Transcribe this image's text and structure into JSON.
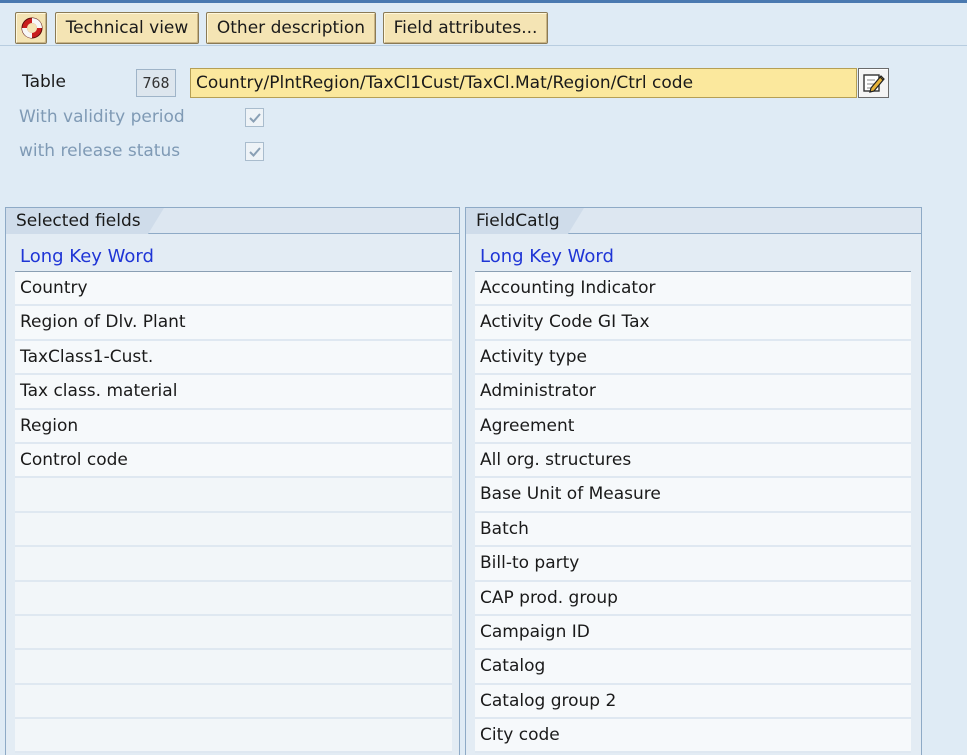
{
  "toolbar": {
    "icon": "sap-lifebuoy-icon",
    "technical_view": "Technical view",
    "other_description": "Other description",
    "field_attributes": "Field attributes..."
  },
  "header": {
    "table_label": "Table",
    "table_number": "768",
    "table_description": "Country/PlntRegion/TaxCl1Cust/TaxCl.Mat/Region/Ctrl code",
    "validity_label": "With validity period",
    "validity_checked": true,
    "release_label": "with release status",
    "release_checked": true
  },
  "selected": {
    "title": "Selected fields",
    "column": "Long Key Word",
    "rows": [
      "Country",
      "Region of Dlv. Plant",
      "TaxClass1-Cust.",
      "Tax class. material",
      "Region",
      "Control code",
      "",
      "",
      "",
      "",
      "",
      "",
      "",
      ""
    ]
  },
  "catalog": {
    "title": "FieldCatlg",
    "column": "Long Key Word",
    "rows": [
      "Accounting Indicator",
      "Activity Code GI Tax",
      "Activity type",
      "Administrator",
      "Agreement",
      "All org. structures",
      "Base Unit of Measure",
      "Batch",
      "Bill-to party",
      "CAP prod. group",
      "Campaign ID",
      "Catalog",
      "Catalog group 2",
      "City code"
    ]
  },
  "colors": {
    "accent_blue": "#1f35d6",
    "button_bg": "#f4e4b4",
    "field_bg": "#fbe89d",
    "window_bg": "#dfebf5"
  }
}
